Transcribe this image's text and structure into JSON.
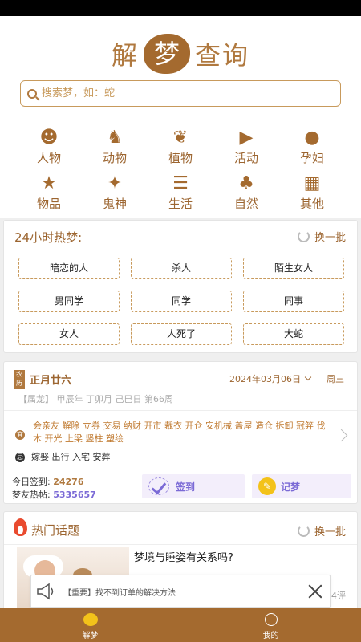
{
  "header": {
    "logo_left": "解",
    "logo_mid": "梦",
    "logo_right": "查询"
  },
  "search": {
    "placeholder": "搜索梦，如：蛇"
  },
  "categories": [
    {
      "label": "人物",
      "icon": "people-icon"
    },
    {
      "label": "动物",
      "icon": "deer-icon"
    },
    {
      "label": "植物",
      "icon": "plant-icon"
    },
    {
      "label": "活动",
      "icon": "megaphone-icon"
    },
    {
      "label": "孕妇",
      "icon": "pregnant-icon"
    },
    {
      "label": "物品",
      "icon": "bag-icon"
    },
    {
      "label": "鬼神",
      "icon": "ghost-icon"
    },
    {
      "label": "生活",
      "icon": "bowl-icon"
    },
    {
      "label": "自然",
      "icon": "tree-icon"
    },
    {
      "label": "其他",
      "icon": "grid-icon"
    }
  ],
  "hot_dreams": {
    "title": "24小时热梦:",
    "refresh_label": "换一批",
    "tags": [
      "暗恋的人",
      "杀人",
      "陌生女人",
      "男同学",
      "同学",
      "同事",
      "女人",
      "人死了",
      "大蛇"
    ]
  },
  "calendar": {
    "badge": "农历",
    "lunar_date": "正月廿六",
    "solar_date": "2024年03月06日",
    "weekday": "周三",
    "ganzhi": "【属龙】 甲辰年 丁卯月 己巳日 第66周",
    "yi_badge": "宜",
    "yi_text": "会亲友 解除 立券 交易 纳财 开市 裁衣 开仓 安机械 盖屋 造仓 拆卸 冠笄 伐木 开光 上梁 竖柱 塑绘",
    "ji_badge": "忌",
    "ji_text": "嫁娶 出行 入宅 安葬",
    "signin_label": "今日签到:",
    "signin_count": "24276",
    "posts_label": "梦友热帖:",
    "posts_count": "5335657",
    "sign_button": "签到",
    "record_button": "记梦"
  },
  "topics": {
    "title": "热门话题",
    "refresh_label": "换一批",
    "question": "梦境与睡姿有关系吗?",
    "comments": "4评"
  },
  "notice": {
    "text": "【重要】找不到订单的解决方法"
  },
  "tabbar": {
    "dream_label": "解梦",
    "me_label": "我的"
  },
  "colors": {
    "brand": "#a46a2f",
    "accent_text": "#9c6530",
    "purple": "#7b6ad6",
    "flame": "#e94b2f"
  }
}
